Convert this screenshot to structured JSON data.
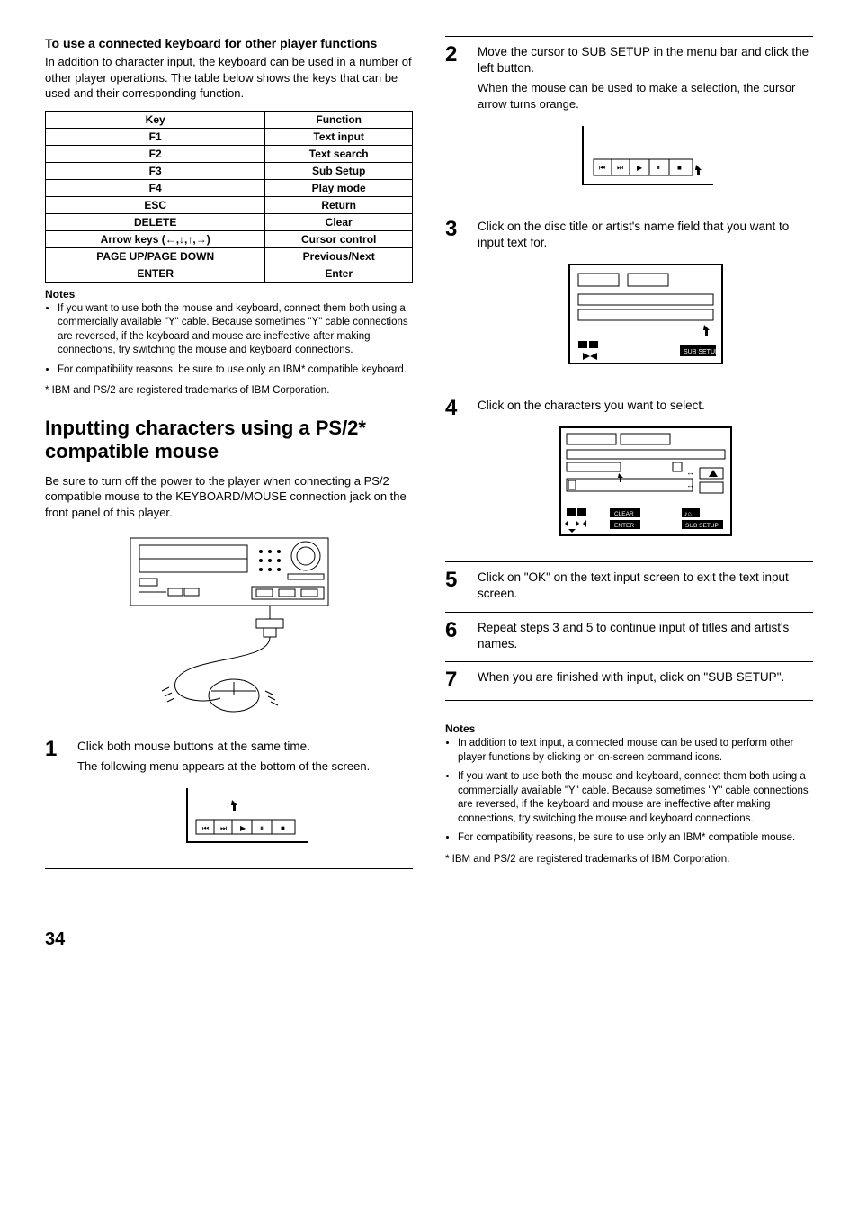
{
  "left": {
    "kb_title": "To use a connected keyboard for other player functions",
    "kb_intro": "In addition to character input, the keyboard can be used in a number of other player operations. The table below shows the keys that can be used and their corresponding function.",
    "table": {
      "head_key": "Key",
      "head_func": "Function",
      "rows": [
        {
          "k": "F1",
          "f": "Text input"
        },
        {
          "k": "F2",
          "f": "Text search"
        },
        {
          "k": "F3",
          "f": "Sub Setup"
        },
        {
          "k": "F4",
          "f": "Play mode"
        },
        {
          "k": "ESC",
          "f": "Return"
        },
        {
          "k": "DELETE",
          "f": "Clear"
        },
        {
          "k": "Arrow keys (←,↓,↑,→)",
          "f": "Cursor control"
        },
        {
          "k": "PAGE UP/PAGE DOWN",
          "f": "Previous/Next"
        },
        {
          "k": "ENTER",
          "f": "Enter"
        }
      ]
    },
    "notes_label": "Notes",
    "notes": [
      "If you want to use both the mouse and keyboard, connect them both using a commercially available \"Y\" cable. Because sometimes \"Y\" cable connections are reversed, if the keyboard and mouse are ineffective after making connections, try switching the mouse and keyboard connections.",
      "For compatibility reasons, be sure to use only an IBM* compatible keyboard."
    ],
    "ibm_foot": "* IBM and PS/2 are registered trademarks of IBM Corporation.",
    "section_title": "Inputting characters using a PS/2* compatible mouse",
    "section_intro": "Be sure to turn off the power to the player when connecting a PS/2 compatible mouse to the KEYBOARD/MOUSE connection jack on the front panel of this player.",
    "step1_main": "Click both mouse buttons at the same time.",
    "step1_sub": "The following menu appears at the bottom of the screen."
  },
  "right": {
    "step2_main": "Move the cursor to SUB SETUP in the menu bar and click the left button.",
    "step2_sub": "When the mouse can be used to make a selection, the cursor arrow turns orange.",
    "step3_main": "Click on the disc title or artist's name field that you want to input text for.",
    "step4_main": "Click on the characters you want to select.",
    "step5_main": "Click on \"OK\" on the text input screen to exit the text input screen.",
    "step6_main": "Repeat steps 3 and 5 to continue input of titles and artist's names.",
    "step7_main": "When you are finished with input, click on \"SUB SETUP\".",
    "notes_label": "Notes",
    "notes": [
      "In addition to text input, a connected mouse can be used to perform other player functions by clicking on on-screen command icons.",
      "If you want to use both the mouse and keyboard, connect them both using a commercially available \"Y\" cable. Because sometimes \"Y\" cable connections are reversed, if the keyboard and mouse are ineffective after making connections, try switching the mouse and keyboard connections.",
      "For compatibility reasons, be sure to use only an IBM* compatible mouse."
    ],
    "ibm_foot": "* IBM and PS/2 are registered trademarks of IBM Corporation."
  },
  "labels": {
    "sub_setup": "SUB SETUP",
    "clear": "CLEAR",
    "enter": "ENTER"
  },
  "page_number": "34"
}
